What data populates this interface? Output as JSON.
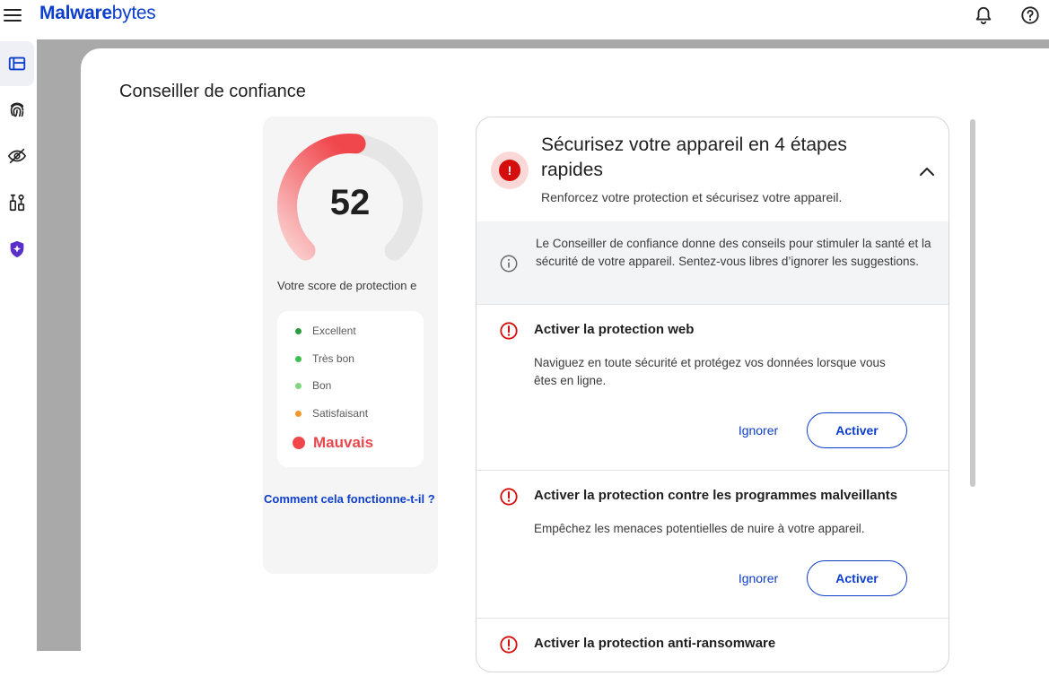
{
  "app": {
    "logo_main": "Malware",
    "logo_light": "bytes"
  },
  "page": {
    "title": "Conseiller de confiance"
  },
  "score": {
    "value": "52",
    "fraction": 0.52,
    "label": "Votre score de protection e",
    "legend": [
      {
        "label": "Excellent",
        "color": "#2e9a3f"
      },
      {
        "label": "Très bon",
        "color": "#3cbf4e"
      },
      {
        "label": "Bon",
        "color": "#7fd67f"
      },
      {
        "label": "Satisfaisant",
        "color": "#f19a2b"
      }
    ],
    "current": {
      "label": "Mauvais",
      "color": "#f0474d"
    },
    "how_link": "Comment cela fonctionne-t-il ?"
  },
  "steps": {
    "title": "Sécurisez votre appareil en 4 étapes rapides",
    "subtitle": "Renforcez votre protection et sécurisez votre appareil.",
    "info": "Le Conseiller de confiance donne des conseils pour stimuler la santé et la sécurité de votre appareil. Sentez-vous libres d’ignorer les suggestions.",
    "tasks": [
      {
        "title": "Activer la protection web",
        "desc": "Naviguez en toute sécurité et protégez vos données lorsque vous êtes en ligne.",
        "ignore": "Ignorer",
        "activate": "Activer"
      },
      {
        "title": "Activer la protection contre les programmes malveillants",
        "desc": "Empêchez les menaces potentielles de nuire à votre appareil.",
        "ignore": "Ignorer",
        "activate": "Activer"
      },
      {
        "title": "Activer la protection anti-ransomware"
      }
    ]
  },
  "colors": {
    "accent": "#0d3ecc",
    "alert": "#d50d0d",
    "gauge_start": "#f0474d",
    "gauge_track": "#e6e6e6"
  }
}
